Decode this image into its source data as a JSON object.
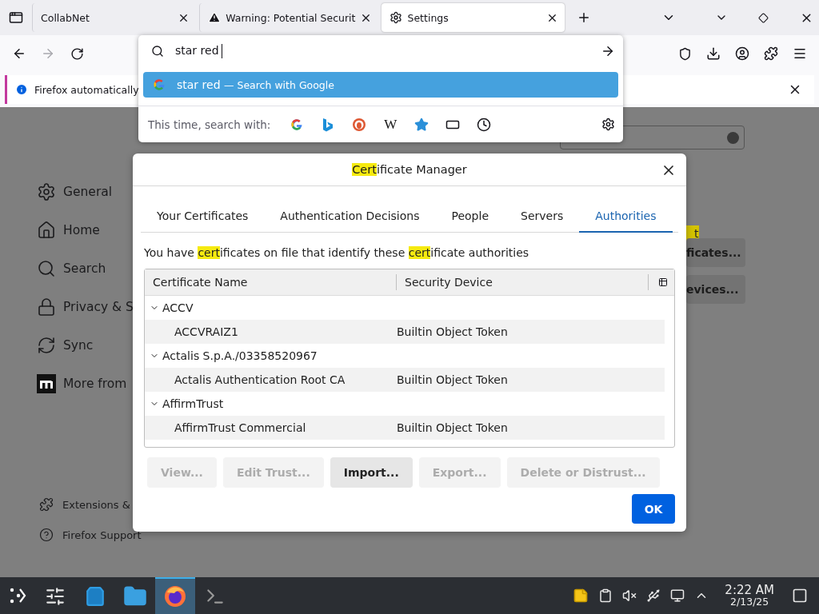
{
  "tabs": [
    {
      "title": "CollabNet",
      "kind": "plain",
      "selected": false
    },
    {
      "title": "Warning: Potential Securit",
      "kind": "warning",
      "selected": false
    },
    {
      "title": "Settings",
      "kind": "settings",
      "selected": true
    }
  ],
  "nav": {
    "back_disabled": false,
    "forward_disabled": true
  },
  "notification": {
    "text": "Firefox automatically"
  },
  "address_dropdown": {
    "value": "star red",
    "suggestion": {
      "text": "star red",
      "separator": "—",
      "action": "Search with Google",
      "selected": true
    },
    "search_with_label": "This time, search with:",
    "engines": [
      {
        "kind": "google"
      },
      {
        "kind": "bing"
      },
      {
        "kind": "duckduckgo"
      },
      {
        "kind": "wikipedia",
        "glyph": "W"
      },
      {
        "kind": "bookmarks"
      },
      {
        "kind": "tabs"
      },
      {
        "kind": "history"
      }
    ]
  },
  "sidebar": {
    "items": [
      {
        "label": "General",
        "kind": "general"
      },
      {
        "label": "Home",
        "kind": "home"
      },
      {
        "label": "Search",
        "kind": "search"
      },
      {
        "label": "Privacy & S",
        "kind": "privacy"
      },
      {
        "label": "Sync",
        "kind": "sync"
      },
      {
        "label": "More from",
        "kind": "more"
      }
    ],
    "footer": [
      {
        "label": "Extensions &",
        "kind": "extensions"
      },
      {
        "label": "Firefox Support",
        "kind": "support"
      }
    ]
  },
  "background_page": {
    "highlight": "t",
    "buttons": [
      "ficates...",
      "evices..."
    ]
  },
  "dialog": {
    "title": [
      {
        "text": "Cert",
        "highlighted": true
      },
      {
        "text": "ificate Manager",
        "highlighted": false
      }
    ],
    "tabs": [
      {
        "label": "Your Certificates",
        "selected": false
      },
      {
        "label": "Authentication Decisions",
        "selected": false
      },
      {
        "label": "People",
        "selected": false
      },
      {
        "label": "Servers",
        "selected": false
      },
      {
        "label": "Authorities",
        "selected": true
      }
    ],
    "description": [
      {
        "text": "You have ",
        "highlighted": false
      },
      {
        "text": "cert",
        "highlighted": true
      },
      {
        "text": "ificates on file that identify these ",
        "highlighted": false
      },
      {
        "text": "cert",
        "highlighted": true
      },
      {
        "text": "ificate authorities",
        "highlighted": false
      }
    ],
    "columns": [
      "Certificate Name",
      "Security Device"
    ],
    "tree": [
      {
        "name": "ACCV",
        "expanded": true,
        "children": [
          {
            "name": "ACCVRAIZ1",
            "device": "Builtin Object Token"
          }
        ]
      },
      {
        "name": "Actalis S.p.A./03358520967",
        "expanded": true,
        "children": [
          {
            "name": "Actalis Authentication Root CA",
            "device": "Builtin Object Token"
          }
        ]
      },
      {
        "name": "AffirmTrust",
        "expanded": true,
        "children": [
          {
            "name": "AffirmTrust Commercial",
            "device": "Builtin Object Token"
          }
        ]
      }
    ],
    "buttons": [
      {
        "label": "View...",
        "disabled": true
      },
      {
        "label": "Edit Trust...",
        "disabled": true
      },
      {
        "label": "Import...",
        "disabled": false
      },
      {
        "label": "Export...",
        "disabled": true
      },
      {
        "label": "Delete or Distrust...",
        "disabled": true
      }
    ],
    "ok": "OK"
  },
  "taskbar": {
    "apps": [
      {
        "kind": "settings",
        "selected": false
      },
      {
        "kind": "store",
        "selected": false
      },
      {
        "kind": "files",
        "selected": false
      },
      {
        "kind": "firefox",
        "selected": true
      },
      {
        "kind": "terminal",
        "selected": false
      }
    ],
    "time": "2:22 AM",
    "date": "2/13/25"
  }
}
